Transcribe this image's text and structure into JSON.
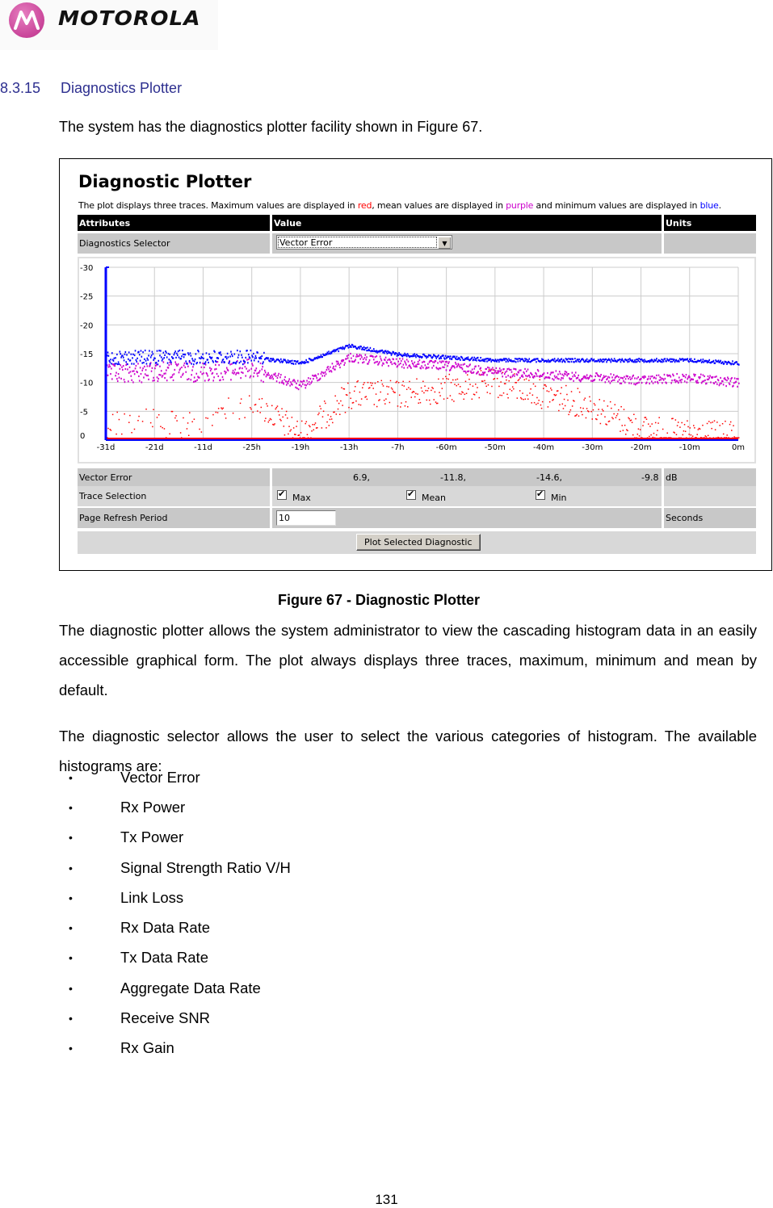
{
  "header": {
    "brand": "MOTOROLA",
    "logo_icon": "motorola-batwing-logo"
  },
  "section": {
    "number": "8.3.15",
    "title": "Diagnostics Plotter"
  },
  "intro_text": "The system has the diagnostics plotter facility shown in Figure 67.",
  "panel": {
    "title": "Diagnostic Plotter",
    "desc_parts": [
      {
        "text": "The plot displays three traces. Maximum values are displayed in ",
        "color": null
      },
      {
        "text": "red",
        "color": "#ff0000"
      },
      {
        "text": ", mean values are displayed in ",
        "color": null
      },
      {
        "text": "purple",
        "color": "#cc00cc"
      },
      {
        "text": " and minimum values are displayed in ",
        "color": null
      },
      {
        "text": "blue",
        "color": "#0000ff"
      },
      {
        "text": ".",
        "color": null
      }
    ],
    "table_headers": {
      "attributes": "Attributes",
      "value": "Value",
      "units": "Units"
    },
    "diagnostics_selector": {
      "label": "Diagnostics Selector",
      "selected": "Vector Error"
    },
    "vector_error": {
      "label": "Vector Error",
      "values": [
        "6.9,",
        "-11.8,",
        "-14.6,",
        "-9.8"
      ],
      "units": "dB"
    },
    "trace_selection": {
      "label": "Trace Selection",
      "options": [
        {
          "label": "Max",
          "checked": true
        },
        {
          "label": "Mean",
          "checked": true
        },
        {
          "label": "Min",
          "checked": true
        }
      ]
    },
    "page_refresh": {
      "label": "Page Refresh Period",
      "value": "10",
      "units": "Seconds"
    },
    "plot_button": "Plot Selected Diagnostic"
  },
  "chart_data": {
    "type": "scatter",
    "title": "",
    "xlabel": "",
    "ylabel": "",
    "y_tick_labels": [
      "0",
      "-5",
      "-10",
      "-15",
      "-20",
      "-25",
      "-30"
    ],
    "y_tick_values": [
      0,
      -5,
      -10,
      -15,
      -20,
      -25,
      -30
    ],
    "ylim": [
      0,
      -30
    ],
    "x_tick_labels": [
      "-31d",
      "-21d",
      "-11d",
      "-25h",
      "-19h",
      "-13h",
      "-7h",
      "-60m",
      "-50m",
      "-40m",
      "-30m",
      "-20m",
      "-10m",
      "0m"
    ],
    "grid": true,
    "series": [
      {
        "name": "Max",
        "color": "#ff0000",
        "description": "sparse scattered points mostly between 0 and -12 dB, densest around -8 to -11 between -13h and -30m",
        "approx_level_by_tick": [
          -3,
          -3,
          -3,
          -7,
          -1,
          -8,
          -8,
          -9,
          -10,
          -8,
          -6,
          -2,
          -1,
          -1
        ]
      },
      {
        "name": "Mean",
        "color": "#cc00cc",
        "description": "noisy trace roughly -9 to -14 dB",
        "approx_level_by_tick": [
          -11.5,
          -12,
          -12,
          -12.5,
          -9.5,
          -14.5,
          -13.5,
          -13,
          -12,
          -11.5,
          -11,
          -10.5,
          -11,
          -10
        ]
      },
      {
        "name": "Min",
        "color": "#0000ff",
        "description": "trace roughly -13 to -17 dB, peak near -13h",
        "approx_level_by_tick": [
          -14.5,
          -14.5,
          -14.5,
          -14.5,
          -13.5,
          -16.5,
          -15,
          -14.5,
          -14,
          -14,
          -14,
          -14,
          -14,
          -13.5
        ]
      }
    ]
  },
  "figure_caption": "Figure 67 - Diagnostic Plotter",
  "paragraph1": "The diagnostic plotter allows the system administrator to view the cascading histogram data in an easily accessible graphical form. The plot always displays three traces, maximum, minimum and mean by default.",
  "paragraph2": "The diagnostic selector allows the user to select the various categories of histogram. The available histograms are:",
  "histograms": [
    "Vector Error",
    "Rx Power",
    "Tx Power",
    "Signal Strength Ratio V/H",
    "Link Loss",
    "Rx Data Rate",
    "Tx Data Rate",
    "Aggregate Data Rate",
    "Receive SNR",
    "Rx Gain"
  ],
  "bullet_glyph": "•",
  "page_number": "131"
}
